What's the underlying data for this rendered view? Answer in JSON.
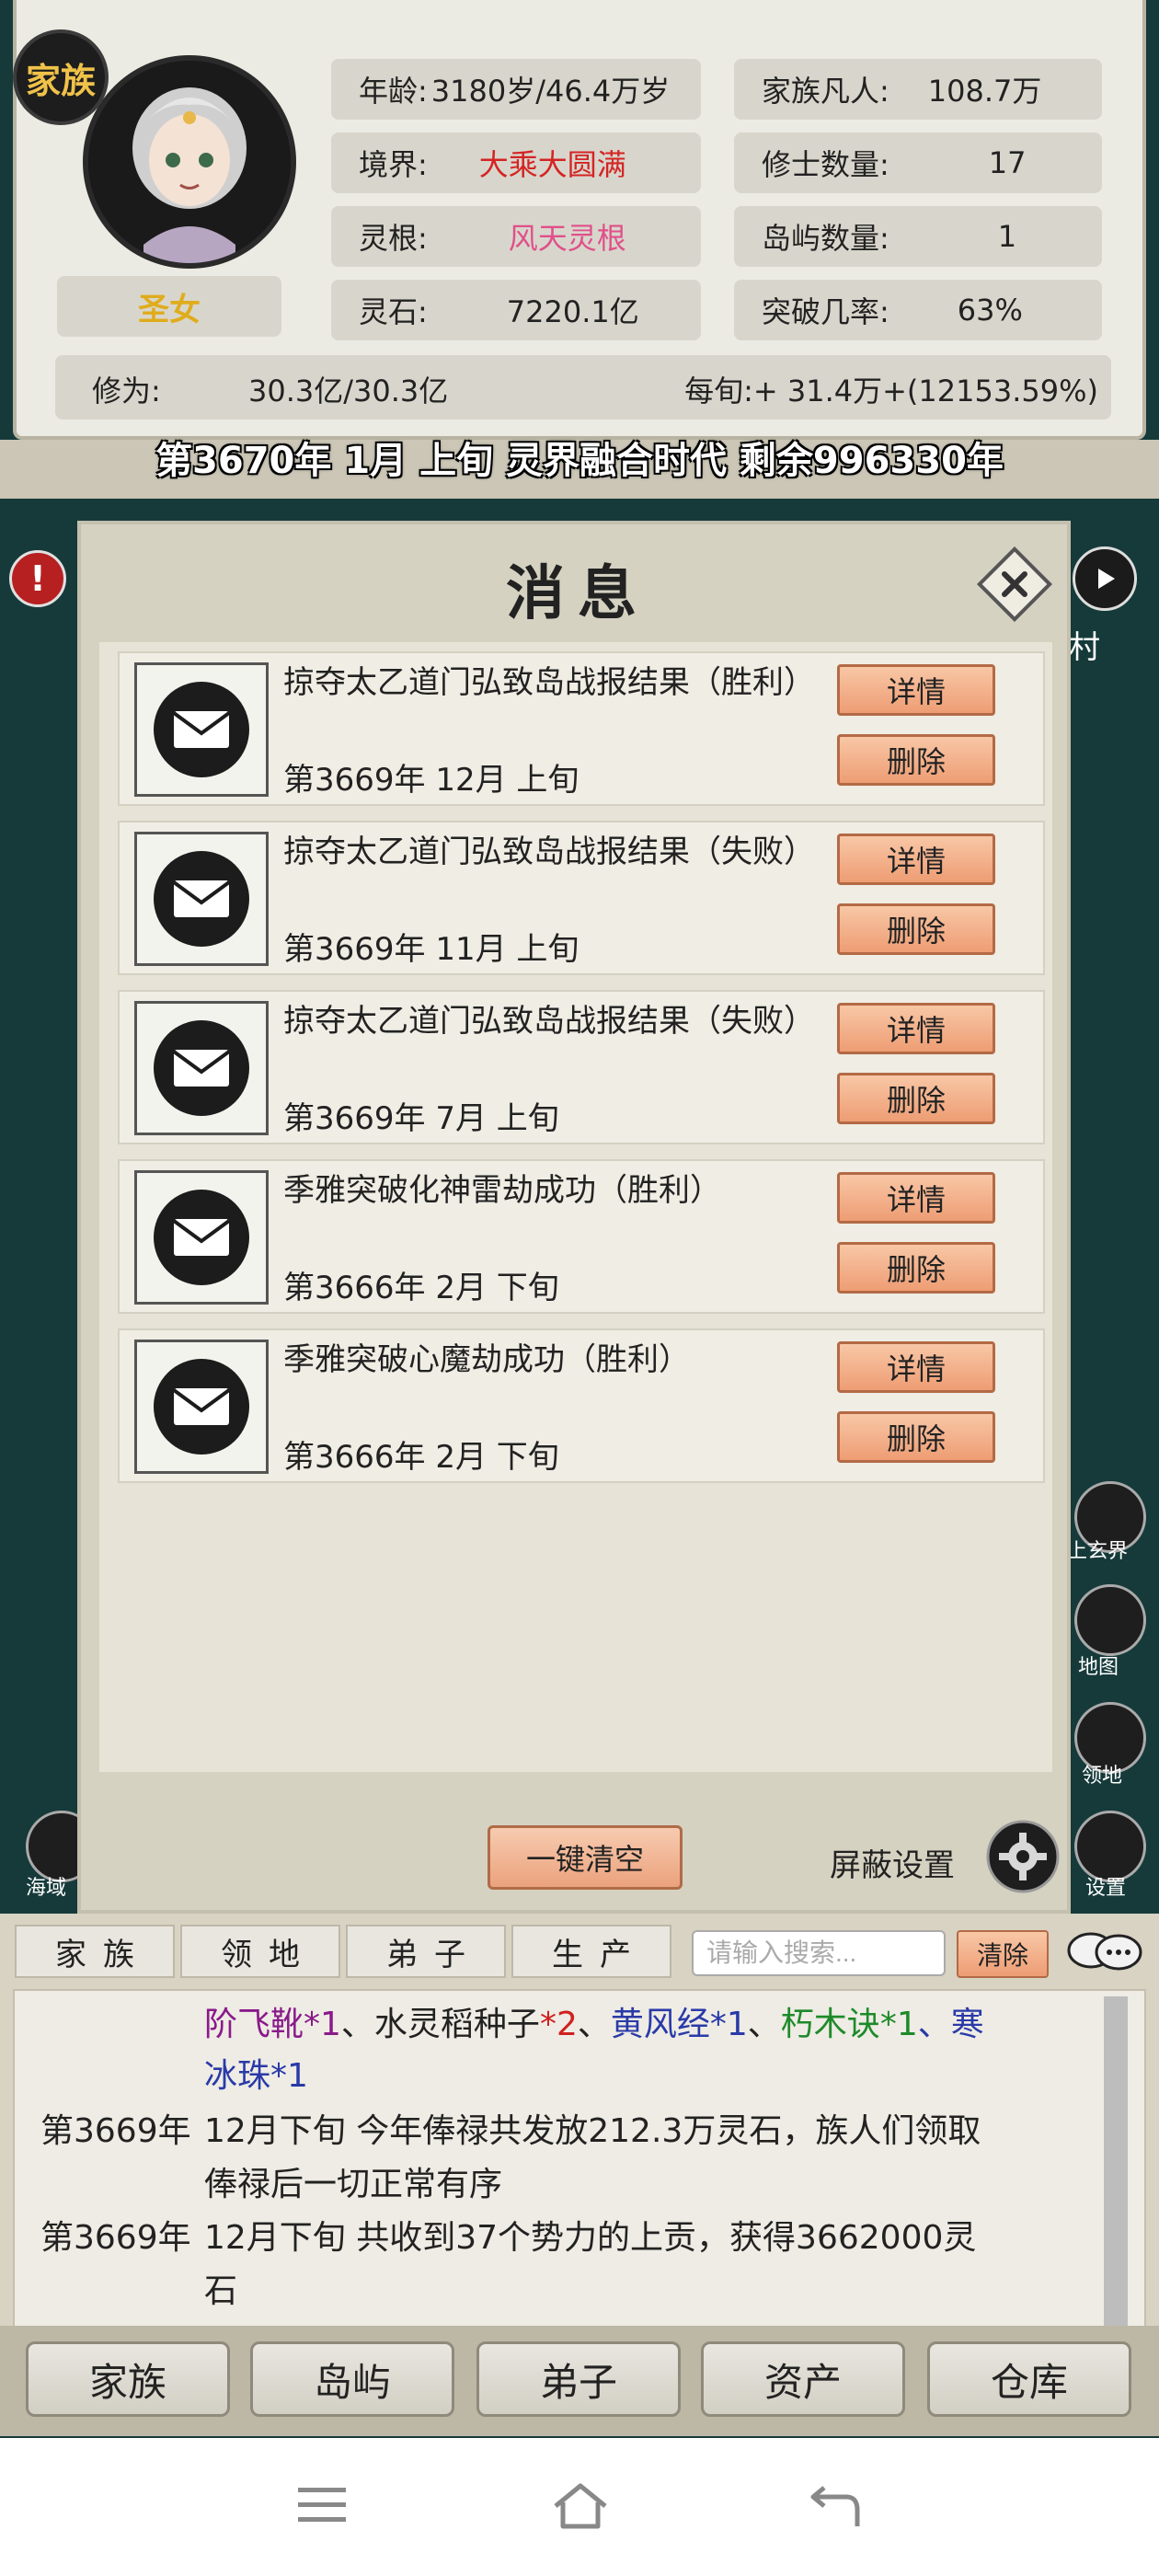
{
  "profile": {
    "family_badge": "家族",
    "title": "圣女",
    "age_label": "年龄:",
    "age_value": "3180岁/46.4万岁",
    "realm_label": "境界:",
    "realm_value": "大乘大圆满",
    "root_label": "灵根:",
    "root_value": "风天灵根",
    "stones_label": "灵石:",
    "stones_value": "7220.1亿",
    "mortals_label": "家族凡人:",
    "mortals_value": "108.7万",
    "cultivators_label": "修士数量:",
    "cultivators_value": "17",
    "islands_label": "岛屿数量:",
    "islands_value": "1",
    "breakthrough_label": "突破几率:",
    "breakthrough_value": "63%",
    "cultivation_label": "修为:",
    "cultivation_value": "30.3亿/30.3亿",
    "per_period": "每旬:+ 31.4万+(12153.59%)"
  },
  "date_line": "第3670年 1月 上旬  灵界融合时代 剩余996330年",
  "background": {
    "right_text": "村"
  },
  "dialog": {
    "title": "消息",
    "detail_label": "详情",
    "delete_label": "删除",
    "messages": [
      {
        "title": "掠夺太乙道门弘致岛战报结果（胜利）",
        "date": "第3669年 12月 上旬"
      },
      {
        "title": "掠夺太乙道门弘致岛战报结果（失败）",
        "date": "第3669年 11月 上旬"
      },
      {
        "title": "掠夺太乙道门弘致岛战报结果（失败）",
        "date": "第3669年 7月 上旬"
      },
      {
        "title": "季雅突破化神雷劫成功（胜利）",
        "date": "第3666年 2月 下旬"
      },
      {
        "title": "季雅突破心魔劫成功（胜利）",
        "date": "第3666年 2月 下旬"
      }
    ],
    "clear_all": "一键清空",
    "block_settings": "屏蔽设置"
  },
  "side_labels": {
    "upper_realm": "上玄界",
    "map": "地图",
    "land": "领地",
    "sea": "海域",
    "settings": "设置"
  },
  "log": {
    "tabs": [
      "家族",
      "领地",
      "弟子",
      "生产"
    ],
    "search_placeholder": "请输入搜索...",
    "clear": "清除",
    "items_line1_parts": [
      {
        "text": "阶飞靴",
        "color": "#8a1a8a"
      },
      {
        "text": "*1",
        "color": "#8a1a8a"
      },
      {
        "text": "、水灵稻种子",
        "color": "#222222"
      },
      {
        "text": "*2",
        "color": "#d02020"
      },
      {
        "text": "、",
        "color": "#222222"
      },
      {
        "text": "黄风经",
        "color": "#2a3aa8"
      },
      {
        "text": "*1",
        "color": "#2a3aa8"
      },
      {
        "text": "、",
        "color": "#222222"
      },
      {
        "text": "朽木诀",
        "color": "#1e8a2a"
      },
      {
        "text": "*1",
        "color": "#1e8a2a"
      },
      {
        "text": "、寒",
        "color": "#2a3aa8"
      }
    ],
    "items_line2": "冰珠*1",
    "entries": [
      {
        "year": "第3669年",
        "line1": "12月下旬 今年俸禄共发放212.3万灵石，族人们领取",
        "line2": "俸禄后一切正常有序"
      },
      {
        "year": "第3669年",
        "line1": "12月下旬 共收到37个势力的上贡，获得3662000灵",
        "line2": "石"
      }
    ]
  },
  "bottom_nav": [
    "家族",
    "岛屿",
    "弟子",
    "资产",
    "仓库"
  ],
  "colors": {
    "realm": "#d42424",
    "root": "#e0508a",
    "title": "#e0ac1c",
    "button": "#ee9d74"
  }
}
